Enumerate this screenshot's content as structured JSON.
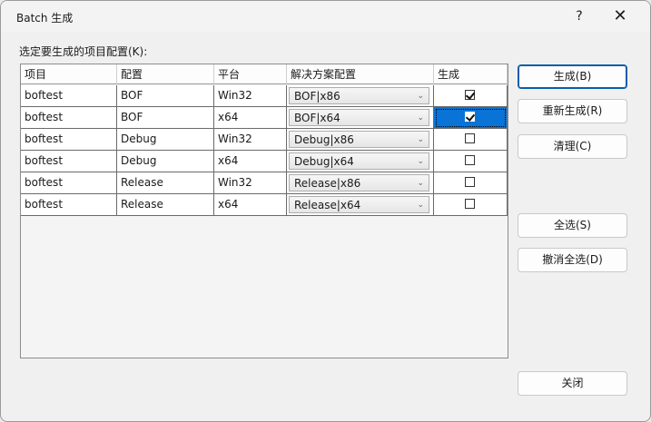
{
  "window": {
    "title": "Batch 生成",
    "help_label": "?",
    "close_label": "✕"
  },
  "list_label": "选定要生成的项目配置(K):",
  "columns": [
    "项目",
    "配置",
    "平台",
    "解决方案配置",
    "生成"
  ],
  "rows": [
    {
      "project": "boftest",
      "config": "BOF",
      "platform": "Win32",
      "solution_config": "BOF|x86",
      "build": true,
      "selected": false
    },
    {
      "project": "boftest",
      "config": "BOF",
      "platform": "x64",
      "solution_config": "BOF|x64",
      "build": true,
      "selected": true
    },
    {
      "project": "boftest",
      "config": "Debug",
      "platform": "Win32",
      "solution_config": "Debug|x86",
      "build": false,
      "selected": false
    },
    {
      "project": "boftest",
      "config": "Debug",
      "platform": "x64",
      "solution_config": "Debug|x64",
      "build": false,
      "selected": false
    },
    {
      "project": "boftest",
      "config": "Release",
      "platform": "Win32",
      "solution_config": "Release|x86",
      "build": false,
      "selected": false
    },
    {
      "project": "boftest",
      "config": "Release",
      "platform": "x64",
      "solution_config": "Release|x64",
      "build": false,
      "selected": false
    }
  ],
  "buttons": {
    "build": "生成(B)",
    "rebuild": "重新生成(R)",
    "clean": "清理(C)",
    "select_all": "全选(S)",
    "deselect_all": "撤消全选(D)",
    "close": "关闭"
  },
  "colors": {
    "selection": "#0a74d6",
    "default_button_border": "#0a5ea8"
  }
}
